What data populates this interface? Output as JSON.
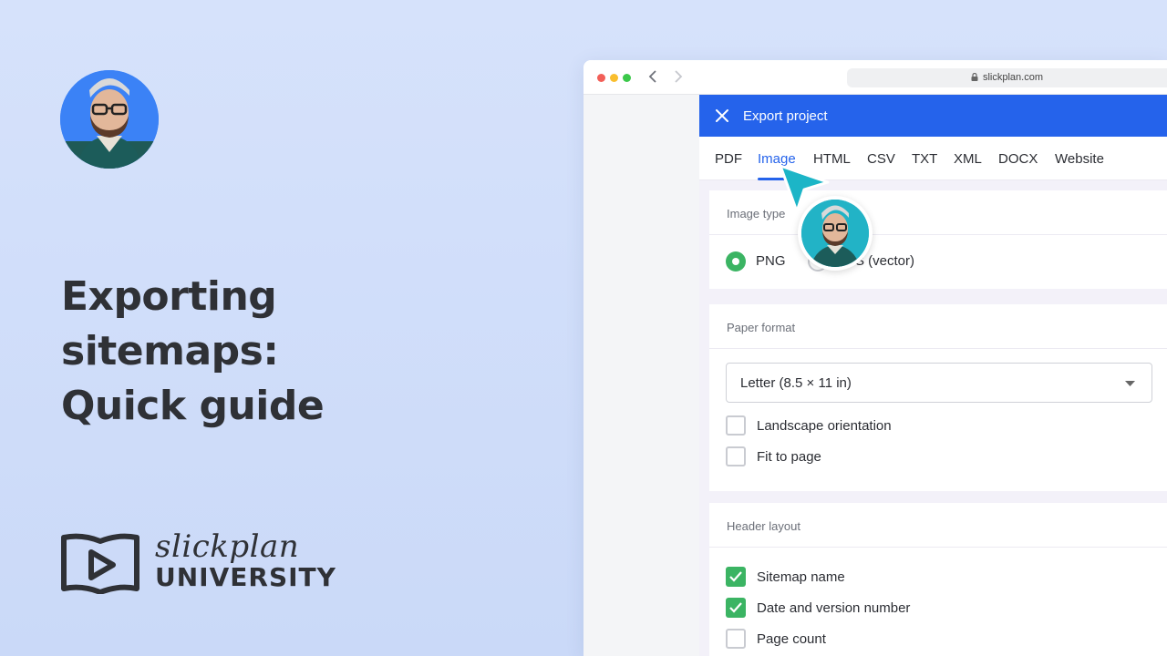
{
  "hero": {
    "headline": [
      "Exporting",
      "sitemaps:",
      "Quick guide"
    ],
    "brand_script": "slickplan",
    "brand_wordmark": "UNIVERSITY"
  },
  "browser": {
    "url": "slickplan.com"
  },
  "dialog": {
    "title": "Export project",
    "tabs": [
      {
        "label": "PDF",
        "active": false
      },
      {
        "label": "Image",
        "active": true
      },
      {
        "label": "HTML",
        "active": false
      },
      {
        "label": "CSV",
        "active": false
      },
      {
        "label": "TXT",
        "active": false
      },
      {
        "label": "XML",
        "active": false
      },
      {
        "label": "DOCX",
        "active": false
      },
      {
        "label": "Website",
        "active": false
      }
    ],
    "image_type": {
      "title": "Image type",
      "options": [
        {
          "label": "PNG",
          "selected": true
        },
        {
          "label": "S (vector)",
          "selected": false
        }
      ]
    },
    "paper_format": {
      "title": "Paper format",
      "select_value": "Letter (8.5 × 11 in)",
      "checkboxes": [
        {
          "label": "Landscape orientation",
          "checked": false
        },
        {
          "label": "Fit to page",
          "checked": false
        }
      ]
    },
    "header_layout": {
      "title": "Header layout",
      "checkboxes": [
        {
          "label": "Sitemap name",
          "checked": true
        },
        {
          "label": "Date and version number",
          "checked": true
        },
        {
          "label": "Page count",
          "checked": false
        }
      ]
    }
  },
  "colors": {
    "accent": "#2563eb",
    "success": "#3bb463",
    "cursor": "#1cb5c7",
    "headline": "#2f3136"
  }
}
